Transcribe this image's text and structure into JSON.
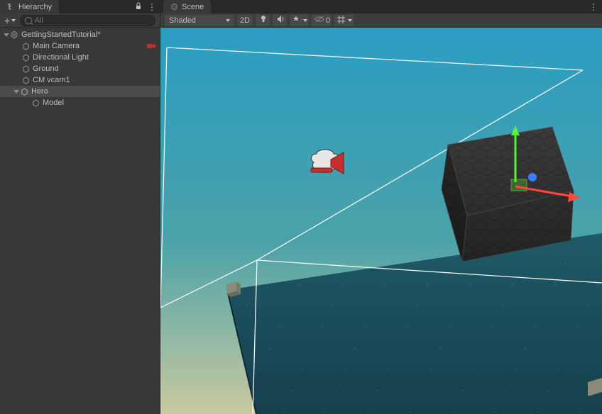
{
  "hierarchy": {
    "tab_label": "Hierarchy",
    "search_placeholder": "All",
    "scene_row": {
      "label": "GettingStartedTutorial*"
    },
    "items": [
      {
        "label": "Main Camera",
        "depth": 1
      },
      {
        "label": "Directional Light",
        "depth": 1
      },
      {
        "label": "Ground",
        "depth": 1
      },
      {
        "label": "CM vcam1",
        "depth": 1
      },
      {
        "label": "Hero",
        "depth": 1,
        "expanded": true,
        "selected": true
      },
      {
        "label": "Model",
        "depth": 2
      }
    ]
  },
  "scene": {
    "tab_label": "Scene",
    "shaded_label": "Shaded",
    "twod_label": "2D",
    "gizmo_count": "0"
  }
}
